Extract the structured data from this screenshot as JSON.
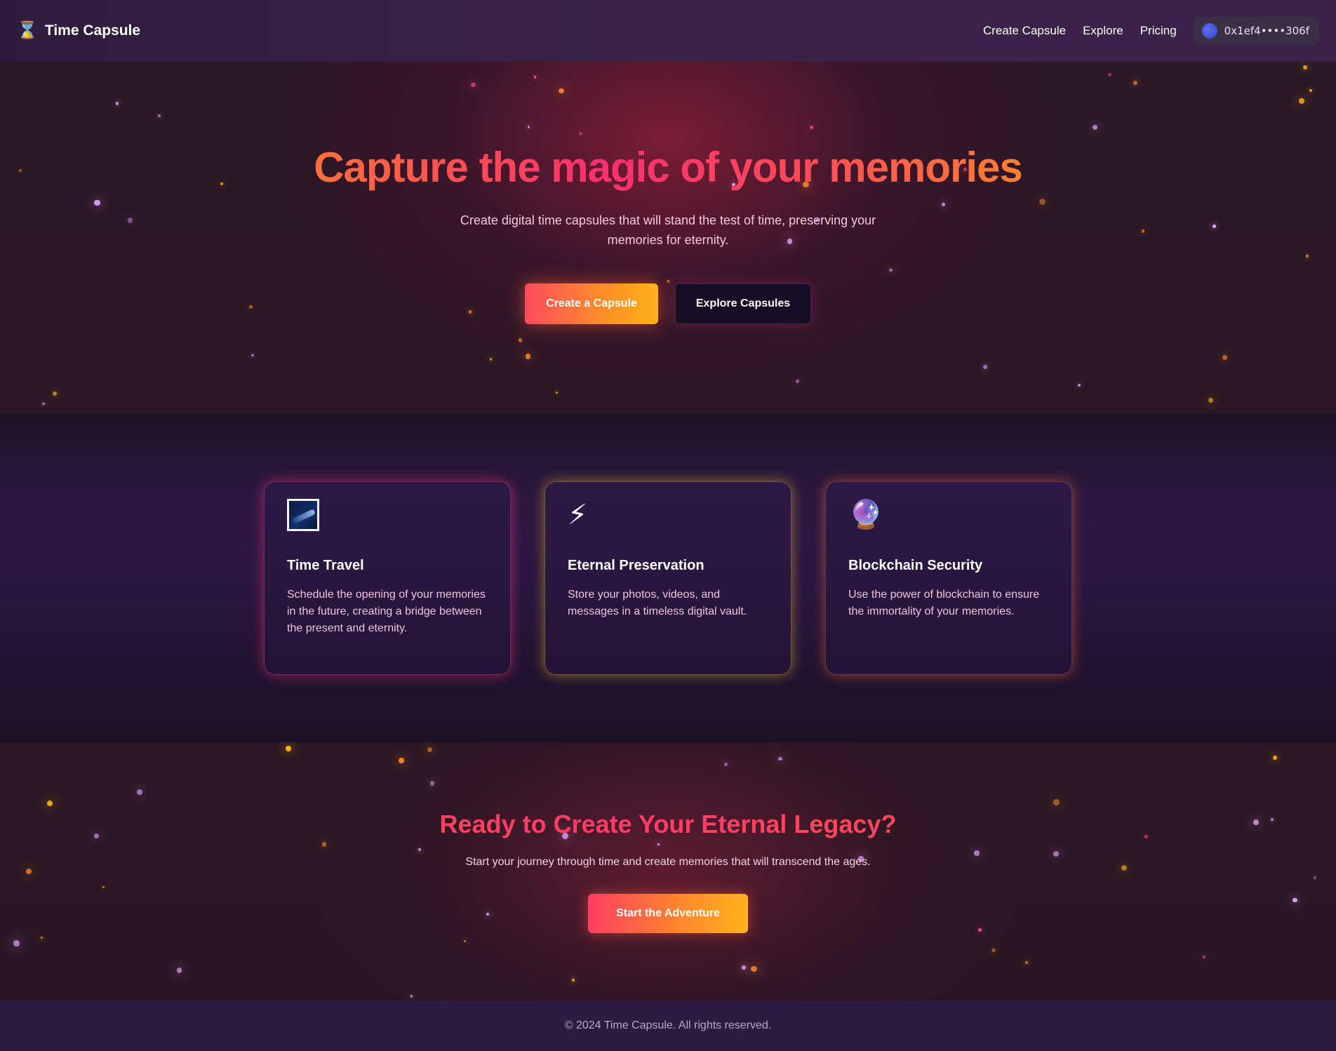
{
  "nav": {
    "brand_icon": "hourglass-icon",
    "brand_name": "Time Capsule",
    "links": [
      "Create Capsule",
      "Explore",
      "Pricing"
    ],
    "wallet_address": "0x1ef4••••306f"
  },
  "hero": {
    "title": "Capture the magic of your memories",
    "subtitle": "Create digital time capsules that will stand the test of time, preserving your memories for eternity.",
    "primary_button": "Create a Capsule",
    "secondary_button": "Explore Capsules"
  },
  "features": [
    {
      "icon": "milky-way-icon",
      "title": "Time Travel",
      "text": "Schedule the opening of your memories in the future, creating a bridge between the present and eternity."
    },
    {
      "icon": "lightning-icon",
      "title": "Eternal Preservation",
      "text": "Store your photos, videos, and messages in a timeless digital vault."
    },
    {
      "icon": "crystal-ball-icon",
      "title": "Blockchain Security",
      "text": "Use the power of blockchain to ensure the immortality of your memories."
    }
  ],
  "cta": {
    "title": "Ready to Create Your Eternal Legacy?",
    "subtitle": "Start your journey through time and create memories that will transcend the ages.",
    "button": "Start the Adventure"
  },
  "footer": {
    "text": "© 2024 Time Capsule. All rights reserved."
  },
  "colors": {
    "accent_orange": "#ffb11a",
    "accent_pink": "#ff3b6b",
    "background_dark": "#1c1226",
    "card_background": "#2a1842"
  }
}
